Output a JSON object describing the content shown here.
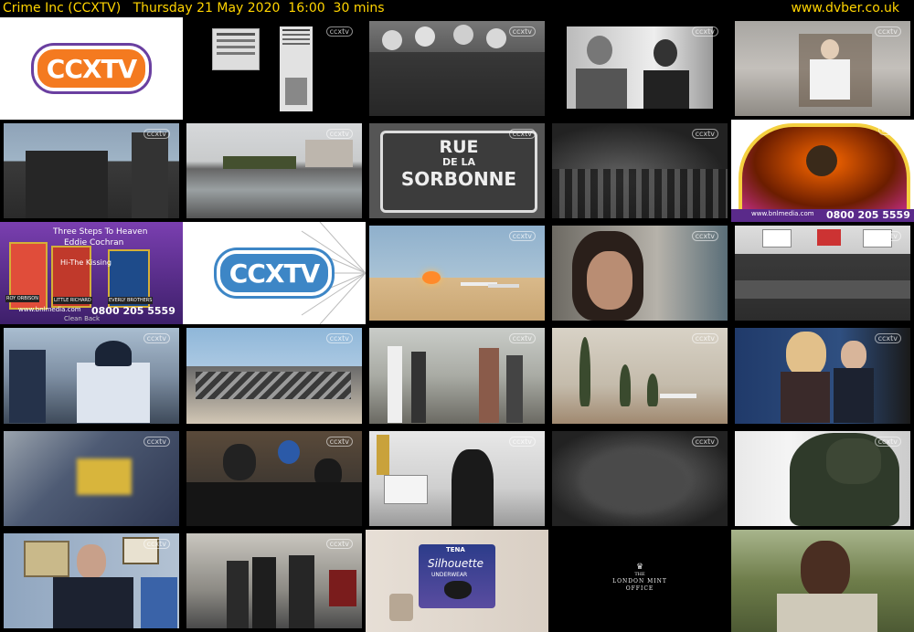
{
  "header": {
    "title": "Crime Inc (CCXTV)   Thursday 21 May 2020  16:00  30 mins",
    "site": "www.dvber.co.uk"
  },
  "colors": {
    "header_text": "#ffd400",
    "logo_orange": "#f47a20",
    "logo_blue": "#3d86c6"
  },
  "channel_bug": "ccxtv",
  "thumbnails": [
    {
      "name": "ccxtv-logo-orange",
      "bug": "",
      "logo": "CCXTV"
    },
    {
      "name": "newspaper-clippings",
      "bug": "ccxtv"
    },
    {
      "name": "group-photo-bw",
      "bug": "ccxtv"
    },
    {
      "name": "couple-photo-bw",
      "bug": "ccxtv"
    },
    {
      "name": "man-in-tshirt",
      "bug": "ccxtv"
    },
    {
      "name": "dark-building",
      "bug": "ccxtv"
    },
    {
      "name": "city-reflecting-pool",
      "bug": "ccxtv"
    },
    {
      "name": "rue-de-la-sorbonne-sign",
      "bug": "ccxtv",
      "sign": [
        "RUE",
        "DE LA",
        "SORBONNE"
      ]
    },
    {
      "name": "crowd-bw",
      "bug": "ccxtv"
    },
    {
      "name": "jukebox-advert",
      "bug": "ccxtv",
      "phone": "0800 205 5559",
      "web": "www.bnlmedia.com"
    },
    {
      "name": "three-steps-to-heaven-advert",
      "bug": "",
      "captions": [
        "Three Steps To Heaven",
        "Eddie Cochran",
        "Hi-The Kissing",
        "Clean Back"
      ],
      "names": [
        "ROY ORBISON",
        "LITTLE RICHARD",
        "EVERLY BROTHERS"
      ],
      "phone": "0800 205 5559",
      "web": "www.bnlmedia.com"
    },
    {
      "name": "ccxtv-logo-blue",
      "bug": "",
      "logo": "CCXTV"
    },
    {
      "name": "desert-plane-explosion",
      "bug": "ccxtv"
    },
    {
      "name": "woman-closeup",
      "bug": "ccxtv"
    },
    {
      "name": "press-conference",
      "bug": "ccxtv"
    },
    {
      "name": "police-officers",
      "bug": "ccxtv"
    },
    {
      "name": "plane-wreckage",
      "bug": "ccxtv"
    },
    {
      "name": "people-on-tarmac",
      "bug": "ccxtv"
    },
    {
      "name": "desert-cypress-trees",
      "bug": "ccxtv"
    },
    {
      "name": "woman-interviewed",
      "bug": "ccxtv"
    },
    {
      "name": "blurry-police-cap",
      "bug": "ccxtv"
    },
    {
      "name": "crowd-street",
      "bug": "ccxtv"
    },
    {
      "name": "street-scene-woman-walking",
      "bug": "ccxtv"
    },
    {
      "name": "blurry-dark-motion",
      "bug": "ccxtv"
    },
    {
      "name": "soldier-back",
      "bug": "ccxtv"
    },
    {
      "name": "man-in-suit-interview",
      "bug": "ccxtv"
    },
    {
      "name": "street-pedestrians",
      "bug": "ccxtv"
    },
    {
      "name": "tena-silhouette-advert",
      "bug": "",
      "brand": "TENA",
      "product": "Silhouette",
      "sub": "UNDERWEAR"
    },
    {
      "name": "london-mint-office-logo",
      "bug": "",
      "lines": [
        "THE",
        "LONDON MINT",
        "OFFICE"
      ]
    },
    {
      "name": "man-outdoor-portrait",
      "bug": ""
    }
  ]
}
